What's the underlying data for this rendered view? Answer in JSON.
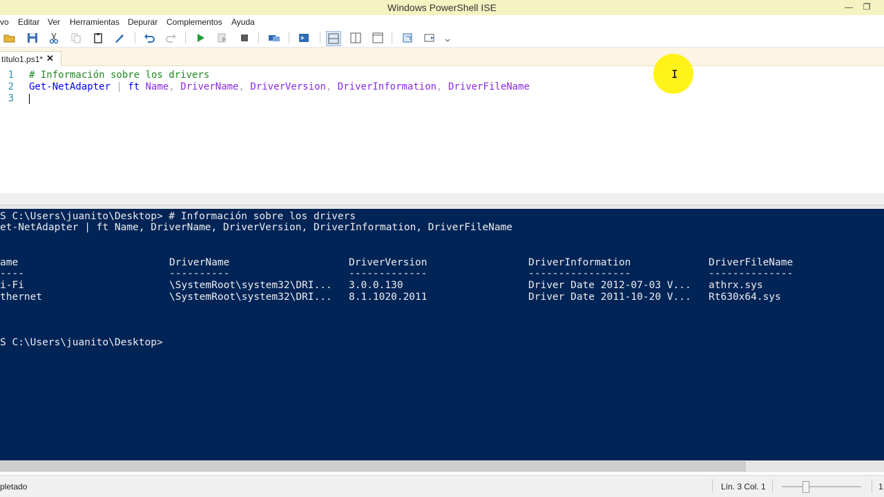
{
  "window": {
    "title": "Windows PowerShell ISE",
    "minimize_glyph": "—",
    "restore_glyph": "❐"
  },
  "menu": [
    "vo",
    "Editar",
    "Ver",
    "Herramientas",
    "Depurar",
    "Complementos",
    "Ayuda"
  ],
  "toolbar_icons": [
    "open-icon",
    "save-icon",
    "cut-icon",
    "copy-icon",
    "paste-icon",
    "clear-icon",
    "undo-icon",
    "redo-icon",
    "run-icon",
    "run-selection-icon",
    "stop-icon",
    "remote-icon",
    "console-icon",
    "layout-top-icon",
    "layout-right-icon",
    "layout-max-icon",
    "snippet-icon",
    "addon-icon",
    "more-icon"
  ],
  "tab": {
    "label": "título1.ps1*",
    "close": "✕"
  },
  "editor": {
    "line_numbers": [
      "1",
      "2",
      "3"
    ],
    "line1_comment": "# Información sobre los drivers",
    "line2": {
      "cmd": "Get-NetAdapter",
      "pipe": " | ",
      "alias": "ft",
      "args": [
        " Name",
        " DriverName",
        " DriverVersion",
        " DriverInformation",
        " DriverFileName"
      ],
      "comma": ","
    }
  },
  "console": {
    "lines": [
      "S C:\\Users\\juanito\\Desktop> # Información sobre los drivers",
      "et-NetAdapter | ft Name, DriverName, DriverVersion, DriverInformation, DriverFileName"
    ],
    "table": {
      "headers": [
        "ame",
        "DriverName",
        "DriverVersion",
        "DriverInformation",
        "DriverFileName"
      ],
      "underlines": [
        "----",
        "----------",
        "-------------",
        "-----------------",
        "--------------"
      ],
      "rows": [
        [
          "i-Fi",
          "\\SystemRoot\\system32\\DRI...",
          "3.0.0.130",
          "Driver Date 2012-07-03 V...",
          "athrx.sys"
        ],
        [
          "thernet",
          "\\SystemRoot\\system32\\DRI...",
          "8.1.1020.2011",
          "Driver Date 2011-10-20 V...",
          "Rt630x64.sys"
        ]
      ]
    },
    "prompt": "S C:\\Users\\juanito\\Desktop>"
  },
  "status": {
    "left": "pletado",
    "position": "Lín. 3  Col. 1",
    "zoom": "1:"
  },
  "colors": {
    "title_bg": "#f6f3c3",
    "console_bg": "#012456",
    "comment": "#1f8a1f",
    "command": "#0000ff",
    "argument": "#8a2be2",
    "cursor_highlight": "#fff200"
  }
}
